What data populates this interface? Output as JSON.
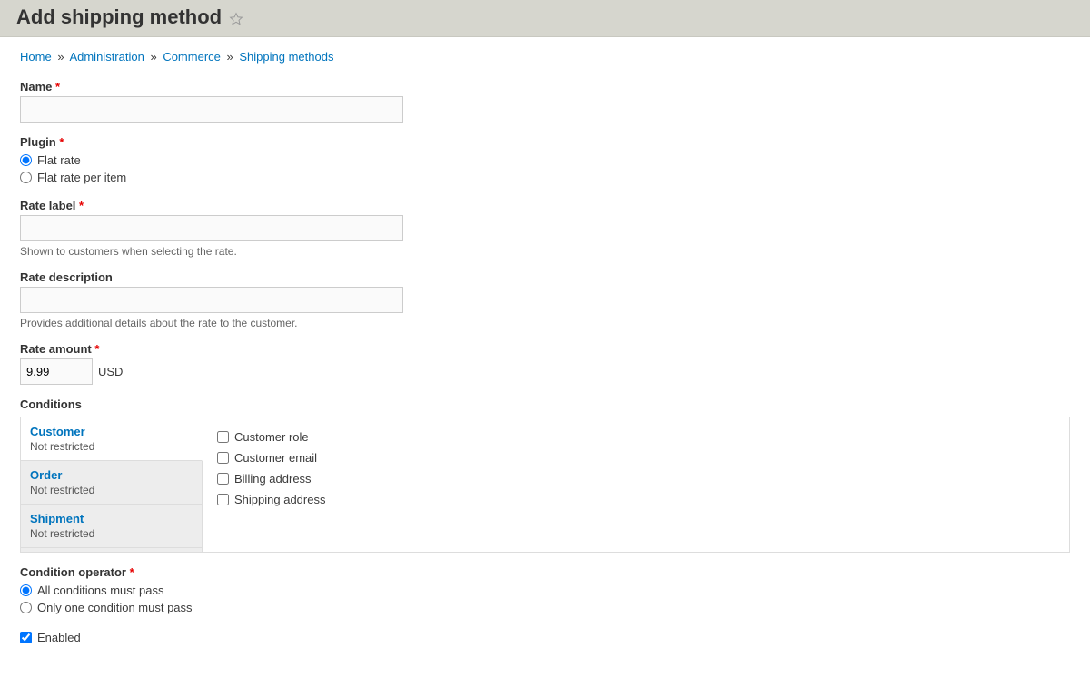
{
  "header": {
    "title": "Add shipping method"
  },
  "breadcrumb": {
    "items": [
      "Home",
      "Administration",
      "Commerce",
      "Shipping methods"
    ],
    "separator": "»"
  },
  "form": {
    "name": {
      "label": "Name",
      "value": ""
    },
    "plugin": {
      "label": "Plugin",
      "options": [
        {
          "label": "Flat rate",
          "checked": true
        },
        {
          "label": "Flat rate per item",
          "checked": false
        }
      ]
    },
    "rate_label": {
      "label": "Rate label",
      "value": "",
      "description": "Shown to customers when selecting the rate."
    },
    "rate_description": {
      "label": "Rate description",
      "value": "",
      "description": "Provides additional details about the rate to the customer."
    },
    "rate_amount": {
      "label": "Rate amount",
      "value": "9.99",
      "currency": "USD"
    },
    "conditions": {
      "label": "Conditions",
      "tabs": [
        {
          "title": "Customer",
          "sub": "Not restricted"
        },
        {
          "title": "Order",
          "sub": "Not restricted"
        },
        {
          "title": "Shipment",
          "sub": "Not restricted"
        }
      ],
      "customer_checks": [
        {
          "label": "Customer role"
        },
        {
          "label": "Customer email"
        },
        {
          "label": "Billing address"
        },
        {
          "label": "Shipping address"
        }
      ]
    },
    "condition_operator": {
      "label": "Condition operator",
      "options": [
        {
          "label": "All conditions must pass",
          "checked": true
        },
        {
          "label": "Only one condition must pass",
          "checked": false
        }
      ]
    },
    "enabled": {
      "label": "Enabled",
      "checked": true
    }
  }
}
